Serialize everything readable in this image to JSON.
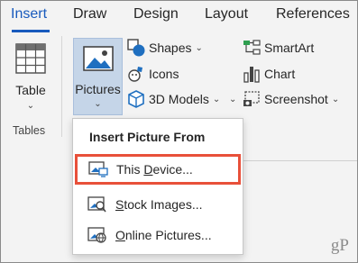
{
  "tabs": [
    "Insert",
    "Draw",
    "Design",
    "Layout",
    "References"
  ],
  "ribbon": {
    "table_label": "Table",
    "tables_group_label": "Tables",
    "pictures_label": "Pictures",
    "shapes_label": "Shapes",
    "icons_label": "Icons",
    "models_label": "3D Models",
    "smartart_label": "SmartArt",
    "chart_label": "Chart",
    "screenshot_label": "Screenshot"
  },
  "menu": {
    "title": "Insert Picture From",
    "items": [
      {
        "label": "This Device...",
        "underline": "D",
        "highlighted": true
      },
      {
        "label": "Stock Images...",
        "underline": "S",
        "highlighted": false
      },
      {
        "label": "Online Pictures...",
        "underline": "O",
        "highlighted": false
      }
    ]
  },
  "watermark": "gP",
  "colors": {
    "accent": "#185abd",
    "highlight_border": "#e8503a",
    "pictures_selected_bg": "#c5d5e8"
  }
}
